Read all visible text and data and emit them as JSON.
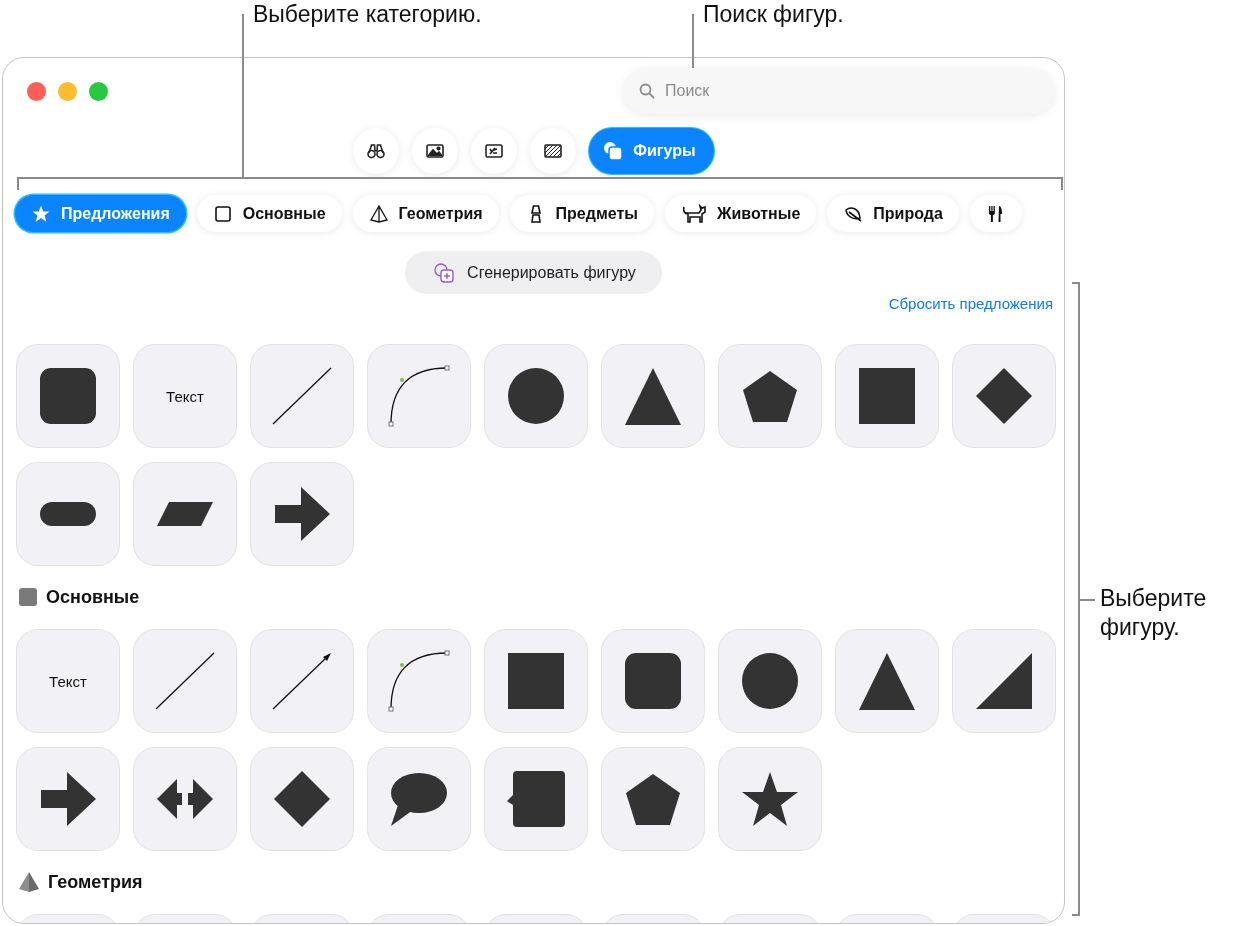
{
  "annotations": [
    {
      "text": "Выберите категорию."
    },
    {
      "text": "Поиск фигур."
    },
    {
      "text": "Выберите фигуру."
    }
  ],
  "window": {
    "traffic_lights": [
      {
        "kind": "close"
      },
      {
        "kind": "minimize"
      },
      {
        "kind": "zoom"
      }
    ],
    "search": {
      "placeholder": "Поиск"
    },
    "toolbar": [
      {
        "selected": false
      },
      {
        "selected": false
      },
      {
        "selected": false
      },
      {
        "selected": false
      },
      {
        "label": "Фигуры",
        "selected": true
      }
    ],
    "categories": [
      {
        "label": "Предложения",
        "selected": true
      },
      {
        "label": "Основные",
        "selected": false
      },
      {
        "label": "Геометрия",
        "selected": false
      },
      {
        "label": "Предметы",
        "selected": false
      },
      {
        "label": "Животные",
        "selected": false
      },
      {
        "label": "Природа",
        "selected": false
      },
      {
        "selected": false
      }
    ],
    "generate_button": "Сгенерировать фигуру",
    "reset_link": "Сбросить предложения",
    "suggestions": [
      {
        "kind": "rounded-square"
      },
      {
        "kind": "text",
        "label": "Текст"
      },
      {
        "kind": "line"
      },
      {
        "kind": "curve"
      },
      {
        "kind": "circle"
      },
      {
        "kind": "triangle"
      },
      {
        "kind": "pentagon"
      },
      {
        "kind": "square"
      },
      {
        "kind": "diamond"
      },
      {
        "kind": "pill"
      },
      {
        "kind": "parallelogram"
      },
      {
        "kind": "arrow"
      }
    ],
    "sections": [
      {
        "title": "Основные",
        "tiles": [
          {
            "kind": "text",
            "label": "Текст"
          },
          {
            "kind": "line"
          },
          {
            "kind": "arrow-line"
          },
          {
            "kind": "curve"
          },
          {
            "kind": "square"
          },
          {
            "kind": "rounded-square"
          },
          {
            "kind": "circle"
          },
          {
            "kind": "triangle"
          },
          {
            "kind": "right-triangle"
          },
          {
            "kind": "arrow"
          },
          {
            "kind": "double-arrow"
          },
          {
            "kind": "diamond"
          },
          {
            "kind": "speech-bubble"
          },
          {
            "kind": "callout-square"
          },
          {
            "kind": "pentagon"
          },
          {
            "kind": "star"
          }
        ]
      },
      {
        "title": "Геометрия",
        "tiles": [
          {
            "kind": "blank"
          },
          {
            "kind": "blank"
          },
          {
            "kind": "blank"
          },
          {
            "kind": "blank"
          },
          {
            "kind": "blank"
          },
          {
            "kind": "blank"
          },
          {
            "kind": "blank"
          },
          {
            "kind": "blank"
          },
          {
            "kind": "blank"
          }
        ]
      }
    ]
  }
}
